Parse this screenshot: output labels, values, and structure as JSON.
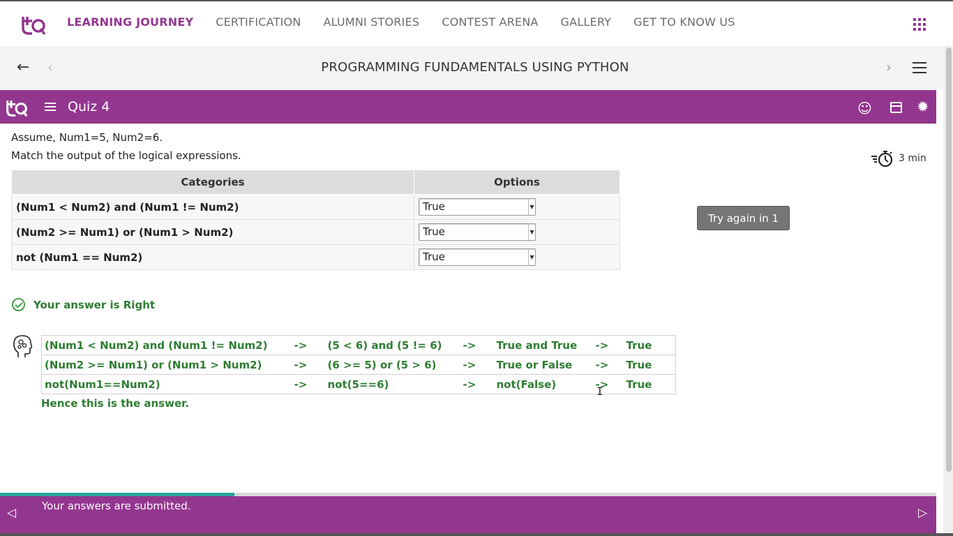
{
  "nav": {
    "items": [
      "LEARNING JOURNEY",
      "CERTIFICATION",
      "ALUMNI STORIES",
      "CONTEST ARENA",
      "GALLERY",
      "GET TO KNOW US"
    ],
    "active_index": 0
  },
  "course": {
    "title": "PROGRAMMING FUNDAMENTALS USING PYTHON"
  },
  "quiz": {
    "title": "Quiz 4",
    "question_line1": "Assume, Num1=5, Num2=6.",
    "question_line2": "Match the output of the logical expressions.",
    "timer": "3 min",
    "table": {
      "headers": [
        "Categories",
        "Options"
      ],
      "rows": [
        {
          "category": "(Num1 < Num2) and (Num1 != Num2)",
          "selected": "True"
        },
        {
          "category": "(Num2 >= Num1) or (Num1 > Num2)",
          "selected": "True"
        },
        {
          "category": "not (Num1 == Num2)",
          "selected": "True"
        }
      ]
    },
    "try_again_label": "Try again in 1",
    "result_text": "Your answer is Right",
    "explanation": {
      "rows": [
        [
          "(Num1 < Num2) and (Num1 != Num2)",
          "->",
          "(5 < 6) and (5 != 6)",
          "->",
          "True and True",
          "->",
          "True"
        ],
        [
          "(Num2 >= Num1) or (Num1 > Num2)",
          "->",
          "(6 >= 5) or (5 > 6)",
          "->",
          "True or False",
          "->",
          "True"
        ],
        [
          "not(Num1==Num2)",
          "->",
          "not(5==6)",
          "->",
          "not(False)",
          "->",
          "True"
        ]
      ],
      "conclusion": "Hence this is the answer."
    }
  },
  "footer": {
    "status": "Your answers are submitted.",
    "progress": 0.25
  },
  "colors": {
    "brand_purple": "#93368f",
    "success_green": "#2e7d32",
    "progress_teal": "#26a69a"
  },
  "icons": [
    "brand-logo-icon",
    "apps-grid-icon",
    "back-arrow-icon",
    "chevron-left-icon",
    "chevron-right-icon",
    "hamburger-menu-icon",
    "smiley-icon",
    "calendar-icon",
    "gear-icon",
    "stopwatch-icon",
    "check-circle-icon",
    "thinking-head-icon",
    "prev-triangle-icon",
    "next-triangle-icon"
  ]
}
